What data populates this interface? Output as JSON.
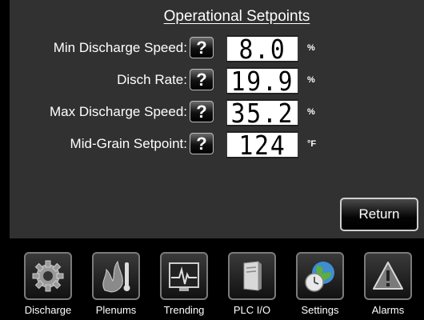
{
  "title": "Operational Setpoints",
  "setpoints": [
    {
      "label": "Min Discharge Speed:",
      "value": "8.0",
      "unit": "%"
    },
    {
      "label": "Disch Rate:",
      "value": "19.9",
      "unit": "%"
    },
    {
      "label": "Max Discharge Speed:",
      "value": "35.2",
      "unit": "%"
    },
    {
      "label": "Mid-Grain Setpoint:",
      "value": "124",
      "unit": "°F"
    }
  ],
  "help_label": "?",
  "return_label": "Return",
  "nav": [
    {
      "label": "Discharge",
      "icon": "gear-icon"
    },
    {
      "label": "Plenums",
      "icon": "flame-thermometer-icon"
    },
    {
      "label": "Trending",
      "icon": "heartbeat-monitor-icon"
    },
    {
      "label": "PLC I/O",
      "icon": "plc-cabinet-icon"
    },
    {
      "label": "Settings",
      "icon": "globe-clock-icon"
    },
    {
      "label": "Alarms",
      "icon": "warning-icon"
    }
  ],
  "colors": {
    "panel": "#313131",
    "background": "#000000",
    "text": "#ffffff",
    "field": "#ffffff"
  }
}
